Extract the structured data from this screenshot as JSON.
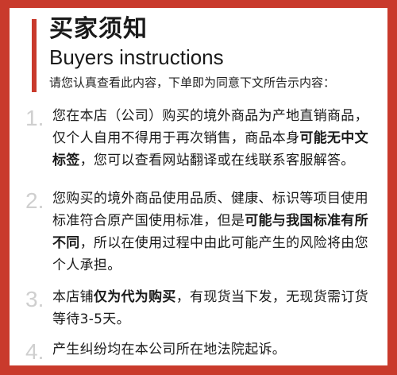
{
  "colors": {
    "frame": "#c93a2c",
    "accent": "#c93a2c",
    "number": "#cfcfcf",
    "text": "#1a1a1a"
  },
  "header": {
    "title_cn": "买家须知",
    "title_en": "Buyers instructions",
    "intro": "请您认真查看此内容，下单即为同意下文所告示内容："
  },
  "items": [
    {
      "number": "1.",
      "parts": [
        {
          "text": "您在本店（公司）购买的境外商品为产地直销商品，仅个人自用不得用于再次销售，商品本身"
        },
        {
          "text": "可能无中文标签",
          "bold": true
        },
        {
          "text": "，您可以查看网站翻译或在线联系客服解答。"
        }
      ]
    },
    {
      "number": "2.",
      "parts": [
        {
          "text": "您购买的境外商品使用品质、健康、标识等项目使用标准符合原产国使用标准，但是"
        },
        {
          "text": "可能与我国标准有所不同",
          "bold": true
        },
        {
          "text": "，所以在使用过程中由此可能产生的风险将由您个人承担。"
        }
      ]
    },
    {
      "number": "3.",
      "parts": [
        {
          "text": "本店铺"
        },
        {
          "text": "仅为代为购买",
          "bold": true
        },
        {
          "text": "，有现货当下发，无现货需订货等待3-5天。"
        }
      ]
    },
    {
      "number": "4.",
      "parts": [
        {
          "text": "产生纠纷均在本公司所在地法院起诉。"
        }
      ]
    }
  ]
}
